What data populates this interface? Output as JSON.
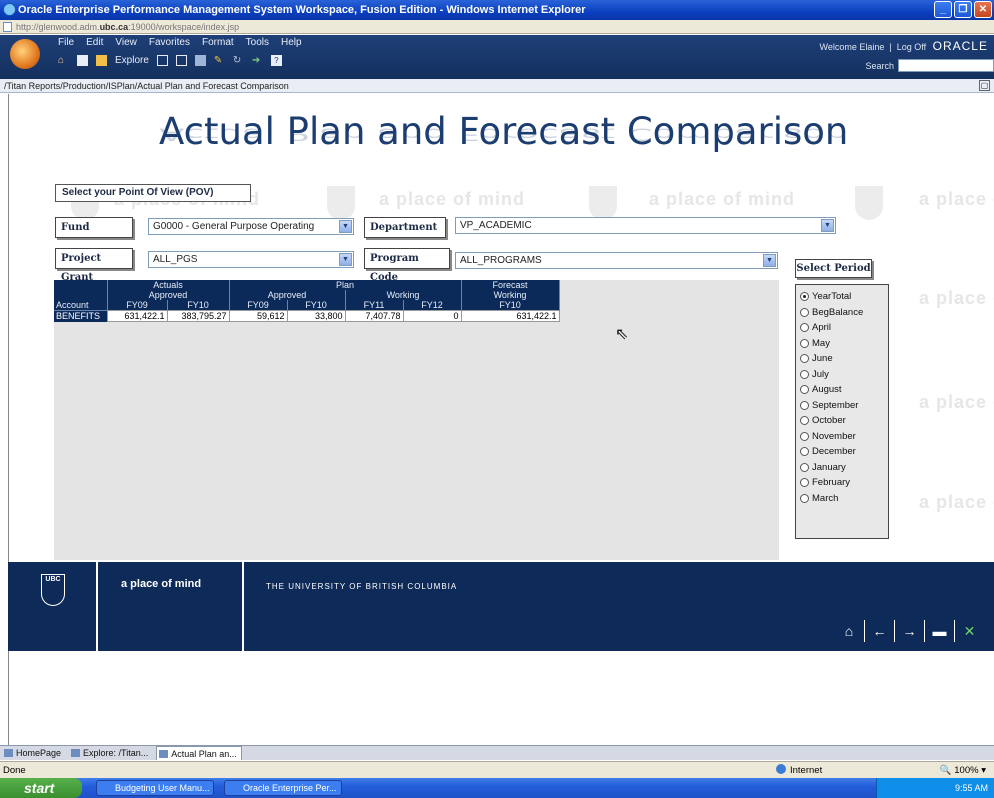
{
  "window": {
    "title": "Oracle Enterprise Performance Management System Workspace, Fusion Edition - Windows Internet Explorer",
    "url_prefix": "http://glenwood.adm.",
    "url_domain": "ubc.ca",
    "url_suffix": ":19000/workspace/index.jsp"
  },
  "menu": [
    "File",
    "Edit",
    "View",
    "Favorites",
    "Format",
    "Tools",
    "Help"
  ],
  "toolbar": {
    "explore_label": "Explore"
  },
  "header": {
    "welcome": "Welcome Elaine",
    "logoff": "Log Off",
    "brand": "ORACLE",
    "search_label": "Search"
  },
  "path": "/Titan Reports/Production/ISPlan/Actual Plan and Forecast Comparison",
  "report": {
    "title": "Actual Plan and Forecast Comparison",
    "watermark": "a place of mind",
    "pov_label": "Select your Point Of View (POV)",
    "fund": {
      "label": "Fund",
      "value": "G0000 - General Purpose Operating"
    },
    "department": {
      "label": "Department",
      "value": "VP_ACADEMIC"
    },
    "project_grant": {
      "label": "Project Grant",
      "value": "ALL_PGS"
    },
    "program_code": {
      "label": "Program Code",
      "value": "ALL_PROGRAMS"
    }
  },
  "grid": {
    "group_headers": [
      "Actuals",
      "Plan",
      "Forecast"
    ],
    "sub_headers": [
      "Approved",
      "Approved",
      "Working",
      "Working"
    ],
    "account_header": "Account",
    "year_headers": [
      "FY09",
      "FY10",
      "FY09",
      "FY10",
      "FY11",
      "FY12",
      "FY10"
    ],
    "rows": [
      {
        "account": "BENEFITS",
        "values": [
          "631,422.1",
          "383,795.27",
          "59,612",
          "33,800",
          "7,407.78",
          "0",
          "631,422.1"
        ]
      }
    ]
  },
  "period": {
    "title": "Select Period",
    "selected": "YearTotal",
    "options": [
      "YearTotal",
      "BegBalance",
      "April",
      "May",
      "June",
      "July",
      "August",
      "September",
      "October",
      "November",
      "December",
      "January",
      "February",
      "March"
    ]
  },
  "footer": {
    "crest_text": "UBC",
    "tagline": "a place of mind",
    "university": "THE UNIVERSITY OF BRITISH COLUMBIA"
  },
  "workspace_tabs": [
    "HomePage",
    "Explore: /Titan...",
    "Actual Plan an..."
  ],
  "status": {
    "text": "Done",
    "zone": "Internet",
    "zoom": "100%"
  },
  "taskbar": {
    "start": "start",
    "tasks": [
      "Budgeting User Manu...",
      "Oracle Enterprise Per..."
    ],
    "clock": "9:55 AM"
  }
}
